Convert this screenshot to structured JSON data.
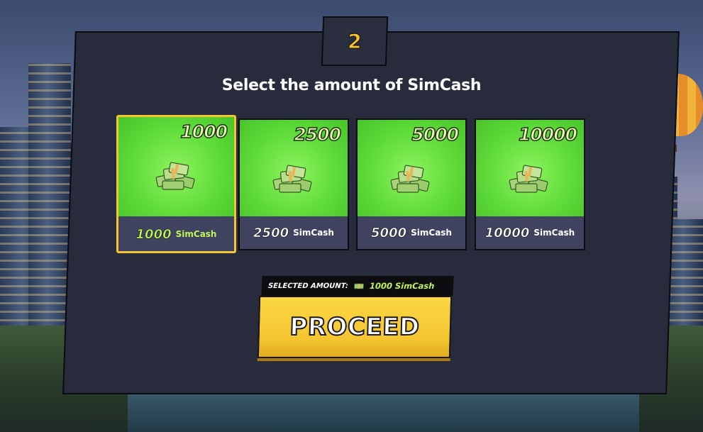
{
  "step": {
    "number": "2"
  },
  "title": "Select the amount of SimCash",
  "cards": [
    {
      "amount": "1000",
      "label_amount": "1000",
      "label_unit": "SimCash",
      "selected": true,
      "icon": "cash-stack-icon"
    },
    {
      "amount": "2500",
      "label_amount": "2500",
      "label_unit": "SimCash",
      "selected": false,
      "icon": "cash-stack-icon"
    },
    {
      "amount": "5000",
      "label_amount": "5000",
      "label_unit": "SimCash",
      "selected": false,
      "icon": "cash-stack-icon"
    },
    {
      "amount": "10000",
      "label_amount": "10000",
      "label_unit": "SimCash",
      "selected": false,
      "icon": "cash-stack-icon"
    }
  ],
  "selection": {
    "label": "SELECTED AMOUNT:",
    "value": "1000 SimCash",
    "icon": "cash-icon"
  },
  "proceed": {
    "label": "PROCEED"
  },
  "colors": {
    "accent": "#f4c531",
    "card_green": "#5fdc3a",
    "selected_text": "#bff55a",
    "panel": "#262a3a"
  }
}
